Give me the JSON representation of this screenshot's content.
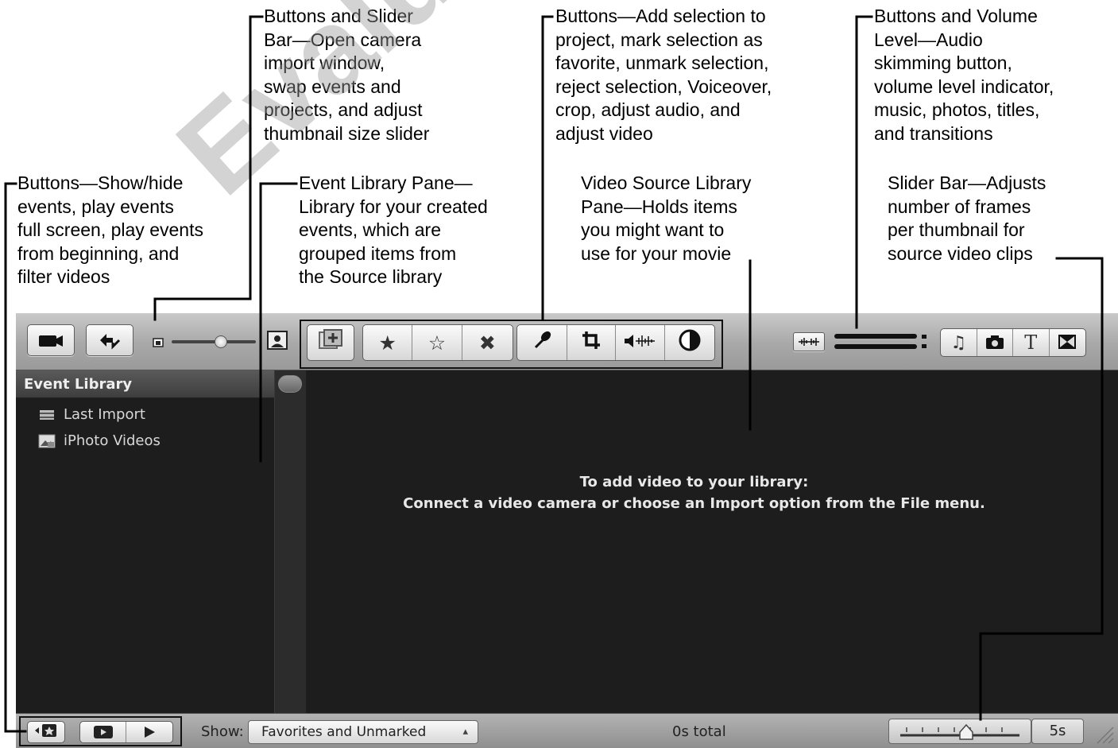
{
  "annotations": [
    {
      "text": "Buttons and Slider\nBar—Open camera\nimport window,\nswap events and\nprojects, and adjust\nthumbnail size slider"
    },
    {
      "text": "Buttons—Add selection to\nproject, mark selection as\nfavorite, unmark selection,\nreject selection, Voiceover,\ncrop, adjust audio, and\nadjust video"
    },
    {
      "text": "Buttons and Volume\nLevel—Audio\nskimming button,\nvolume level indicator,\nmusic, photos, titles,\nand transitions"
    },
    {
      "text": "Buttons—Show/hide\nevents, play events\nfull screen, play events\nfrom beginning, and\nfilter videos"
    },
    {
      "text": "Event Library Pane—\nLibrary for your created\nevents, which are\ngrouped items from\nthe Source library"
    },
    {
      "text": "Video Source Library\nPane—Holds items\nyou might want to\nuse for your movie"
    },
    {
      "text": "Slider Bar—Adjusts\nnumber of frames\nper thumbnail for\nsource video clips"
    }
  ],
  "watermark": "Evaluation",
  "toolbar": {
    "left_buttons": [
      {
        "icon": "camera-icon"
      },
      {
        "icon": "swap-events-projects-icon"
      }
    ],
    "thumbnail_slider": {
      "value": 0.6,
      "min_icon": "small-thumbnail-icon",
      "max_icon": "large-thumbnail-icon"
    },
    "edit_buttons": [
      {
        "icon": "add-selection-to-project-icon"
      },
      {
        "icon": "favorite-star-icon",
        "glyph": "★"
      },
      {
        "icon": "unmark-star-icon",
        "glyph": "☆"
      },
      {
        "icon": "reject-icon",
        "glyph": "✖"
      },
      {
        "icon": "voiceover-microphone-icon"
      },
      {
        "icon": "crop-icon"
      },
      {
        "icon": "adjust-audio-icon"
      },
      {
        "icon": "adjust-video-icon"
      }
    ],
    "right_buttons": [
      {
        "icon": "audio-skimming-icon"
      },
      {
        "icon": "music-icon",
        "glyph": "♫"
      },
      {
        "icon": "photos-camera-icon"
      },
      {
        "icon": "titles-icon",
        "glyph": "T"
      },
      {
        "icon": "transitions-icon"
      }
    ]
  },
  "sidebar": {
    "title": "Event Library",
    "items": [
      {
        "label": "Last Import",
        "icon": "event-film-icon"
      },
      {
        "label": "iPhoto Videos",
        "icon": "iphoto-icon"
      }
    ]
  },
  "main": {
    "message_line1": "To add video to your library:",
    "message_line2": "Connect a video camera or choose an Import option from the File menu."
  },
  "bottom": {
    "show_label": "Show:",
    "filter_value": "Favorites and Unmarked",
    "total": "0s total",
    "frames_per_thumbnail": "5s",
    "frames_slider_value": 0.55
  }
}
